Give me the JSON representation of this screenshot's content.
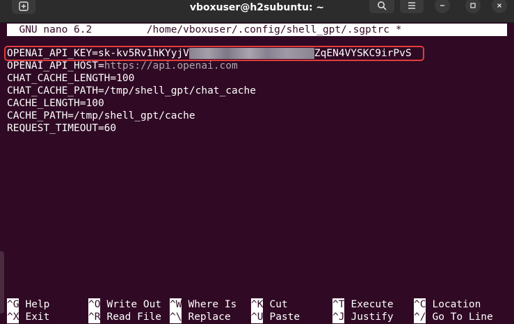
{
  "window": {
    "title": "vboxuser@h2subuntu: ~"
  },
  "nano": {
    "header": "  GNU nano 6.2         /home/vboxuser/.config/shell_gpt/.sgptrc *",
    "lines": [
      {
        "key": "OPENAI_API_KEY=",
        "value_start": "sk-kv5Rv1hKYyjV",
        "value_end": "ZqEN4VYSKC9irPvS"
      },
      {
        "key": "OPENAI_API_HOST=",
        "value": "https://api.openai.com"
      },
      {
        "text": "CHAT_CACHE_LENGTH=100"
      },
      {
        "text": "CHAT_CACHE_PATH=/tmp/shell_gpt/chat_cache"
      },
      {
        "text": "CACHE_LENGTH=100"
      },
      {
        "text": "CACHE_PATH=/tmp/shell_gpt/cache"
      },
      {
        "text": "REQUEST_TIMEOUT=60"
      }
    ],
    "shortcuts": [
      [
        {
          "key": "^G",
          "label": "Help"
        },
        {
          "key": "^O",
          "label": "Write Out"
        },
        {
          "key": "^W",
          "label": "Where Is"
        },
        {
          "key": "^K",
          "label": "Cut"
        },
        {
          "key": "^T",
          "label": "Execute"
        },
        {
          "key": "^C",
          "label": "Location"
        }
      ],
      [
        {
          "key": "^X",
          "label": "Exit"
        },
        {
          "key": "^R",
          "label": "Read File"
        },
        {
          "key": "^\\",
          "label": "Replace"
        },
        {
          "key": "^U",
          "label": "Paste"
        },
        {
          "key": "^J",
          "label": "Justify"
        },
        {
          "key": "^/",
          "label": "Go To Line"
        }
      ]
    ]
  },
  "colors": {
    "terminal_bg": "#300a24",
    "highlight_border": "#e23d3d",
    "titlebar_bg": "#2c2c2c"
  },
  "icons": [
    "new-tab-icon",
    "search-icon",
    "hamburger-menu-icon",
    "minimize-icon",
    "maximize-icon",
    "close-icon"
  ]
}
